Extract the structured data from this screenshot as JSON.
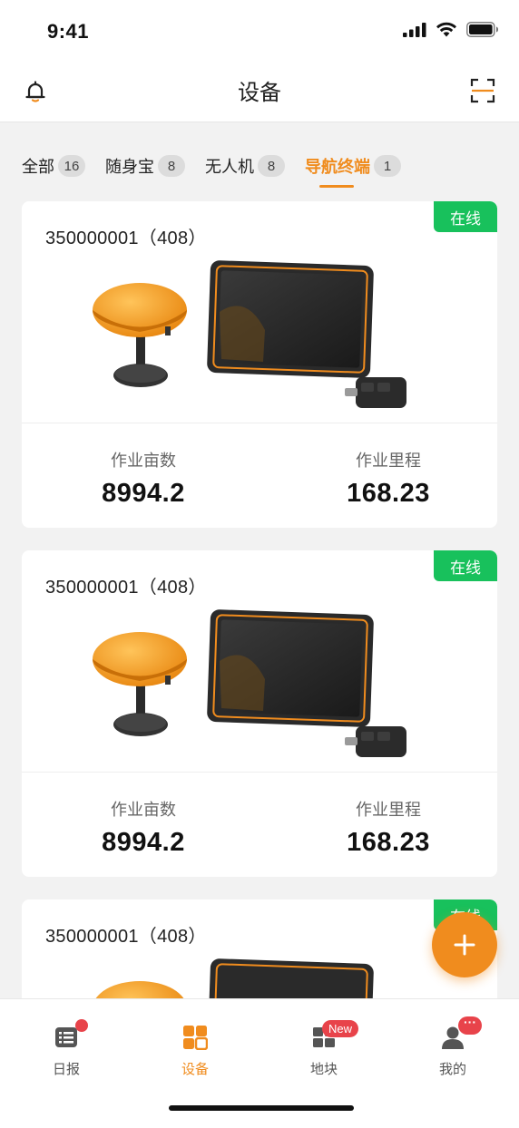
{
  "status_bar": {
    "time": "9:41"
  },
  "header": {
    "title": "设备"
  },
  "tabs": [
    {
      "label": "全部",
      "count": "16",
      "active": false
    },
    {
      "label": "随身宝",
      "count": "8",
      "active": false
    },
    {
      "label": "无人机",
      "count": "8",
      "active": false
    },
    {
      "label": "导航终端",
      "count": "1",
      "active": true
    }
  ],
  "devices": [
    {
      "title": "350000001（408）",
      "status": "在线",
      "stats": [
        {
          "label": "作业亩数",
          "value": "8994.2"
        },
        {
          "label": "作业里程",
          "value": "168.23"
        }
      ]
    },
    {
      "title": "350000001（408）",
      "status": "在线",
      "stats": [
        {
          "label": "作业亩数",
          "value": "8994.2"
        },
        {
          "label": "作业里程",
          "value": "168.23"
        }
      ]
    },
    {
      "title": "350000001（408）",
      "status": "在线"
    }
  ],
  "fab": {
    "icon": "plus-icon"
  },
  "tabbar": {
    "items": [
      {
        "label": "日报",
        "icon": "list-icon",
        "badge": "dot"
      },
      {
        "label": "设备",
        "icon": "grid-icon",
        "active": true
      },
      {
        "label": "地块",
        "icon": "map-icon",
        "badge": "New"
      },
      {
        "label": "我的",
        "icon": "user-icon",
        "badge": "···"
      }
    ]
  },
  "colors": {
    "accent": "#f08c1e",
    "online": "#18c15c",
    "badge": "#e8434a"
  }
}
